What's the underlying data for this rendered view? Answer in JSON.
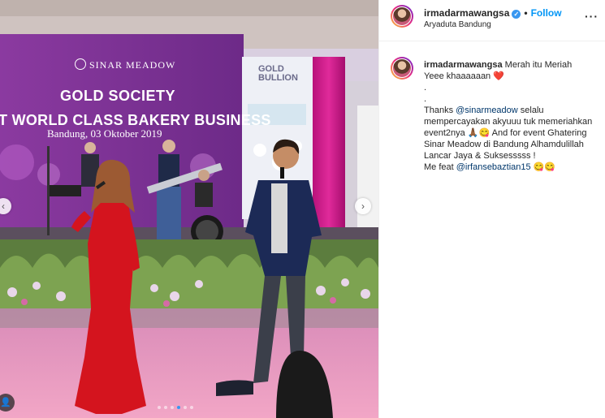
{
  "photo": {
    "banner": {
      "brand": "SINAR MEADOW",
      "title_line1": "GOLD SOCIETY",
      "title_line2": "T WORLD CLASS BAKERY BUSINESS",
      "date": "Bandung, 03 Oktober 2019",
      "sponsor_line1": "GOLD",
      "sponsor_line2": "BULLION"
    },
    "nav_prev": "‹",
    "nav_next": "›",
    "carousel_dots": 6,
    "active_dot": 3,
    "tag_icon": "👤"
  },
  "header": {
    "username": "irmadarmawangsa",
    "verified_icon": "✓",
    "separator": "•",
    "follow_label": "Follow",
    "location": "Aryaduta Bandung",
    "more_icon": "···"
  },
  "caption": {
    "username": "irmadarmawangsa",
    "line1": "Merah itu Meriah",
    "line2": "Yeee khaaaaaan ❤️",
    "dot1": ".",
    "dot2": ".",
    "thanks_prefix": "Thanks ",
    "mention1": "@sinarmeadow",
    "thanks_suffix": " selalu mempercayakan akyuuu tuk memeriahkan event2nya 🙏🏾😋 And for event Ghatering Sinar Meadow di Bandung Alhamdulillah Lancar Jaya & Suksesssss !",
    "feat_prefix": "Me feat ",
    "mention2": "@irfansebaztian15",
    "feat_suffix": " 😋😋"
  },
  "colors": {
    "accent": "#0095f6",
    "mention": "#00376b",
    "banner": "#7a2c8f",
    "dress": "#d4141e"
  }
}
